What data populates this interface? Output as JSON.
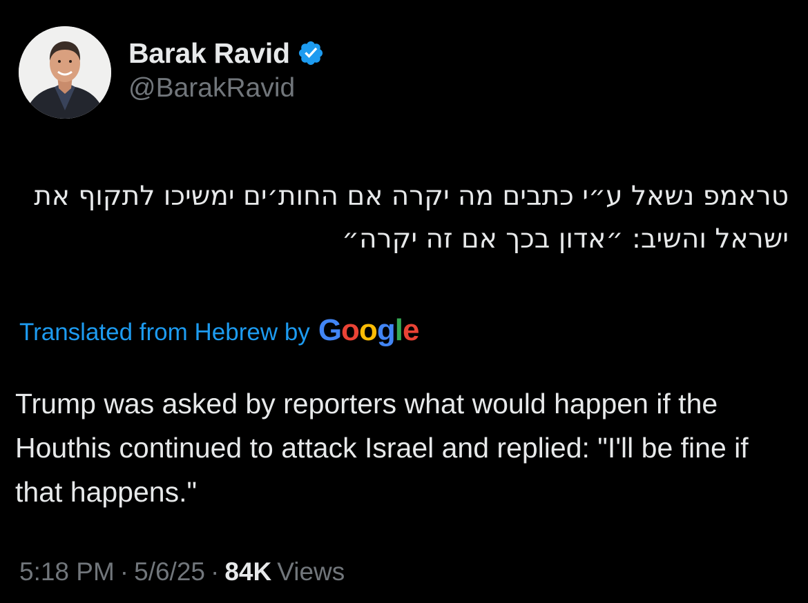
{
  "author": {
    "name": "Barak Ravid",
    "handle": "@BarakRavid",
    "verified": true,
    "verified_icon": "verified-badge-icon",
    "verified_color": "#1d9bf0"
  },
  "tweet": {
    "hebrew_text": "טראמפ נשאל ע״י כתבים מה יקרה אם החות׳ים ימשיכו לתקוף את ישראל והשיב: ״אדון בכך אם זה יקרה״",
    "translation_label": "Translated from Hebrew by",
    "translation_provider": "Google",
    "translated_text": "Trump was asked by reporters what would happen if the Houthis continued to attack Israel and replied: \"I'll be fine if that happens.\"",
    "time": "5:18 PM",
    "date": "5/6/25",
    "views_count": "84K",
    "views_label": "Views",
    "separator": "·"
  },
  "colors": {
    "background": "#000000",
    "text_primary": "#e7e9ea",
    "text_secondary": "#71767b",
    "link": "#1d9bf0",
    "google_blue": "#4285F4",
    "google_red": "#EA4335",
    "google_yellow": "#FBBC05",
    "google_green": "#34A853"
  }
}
